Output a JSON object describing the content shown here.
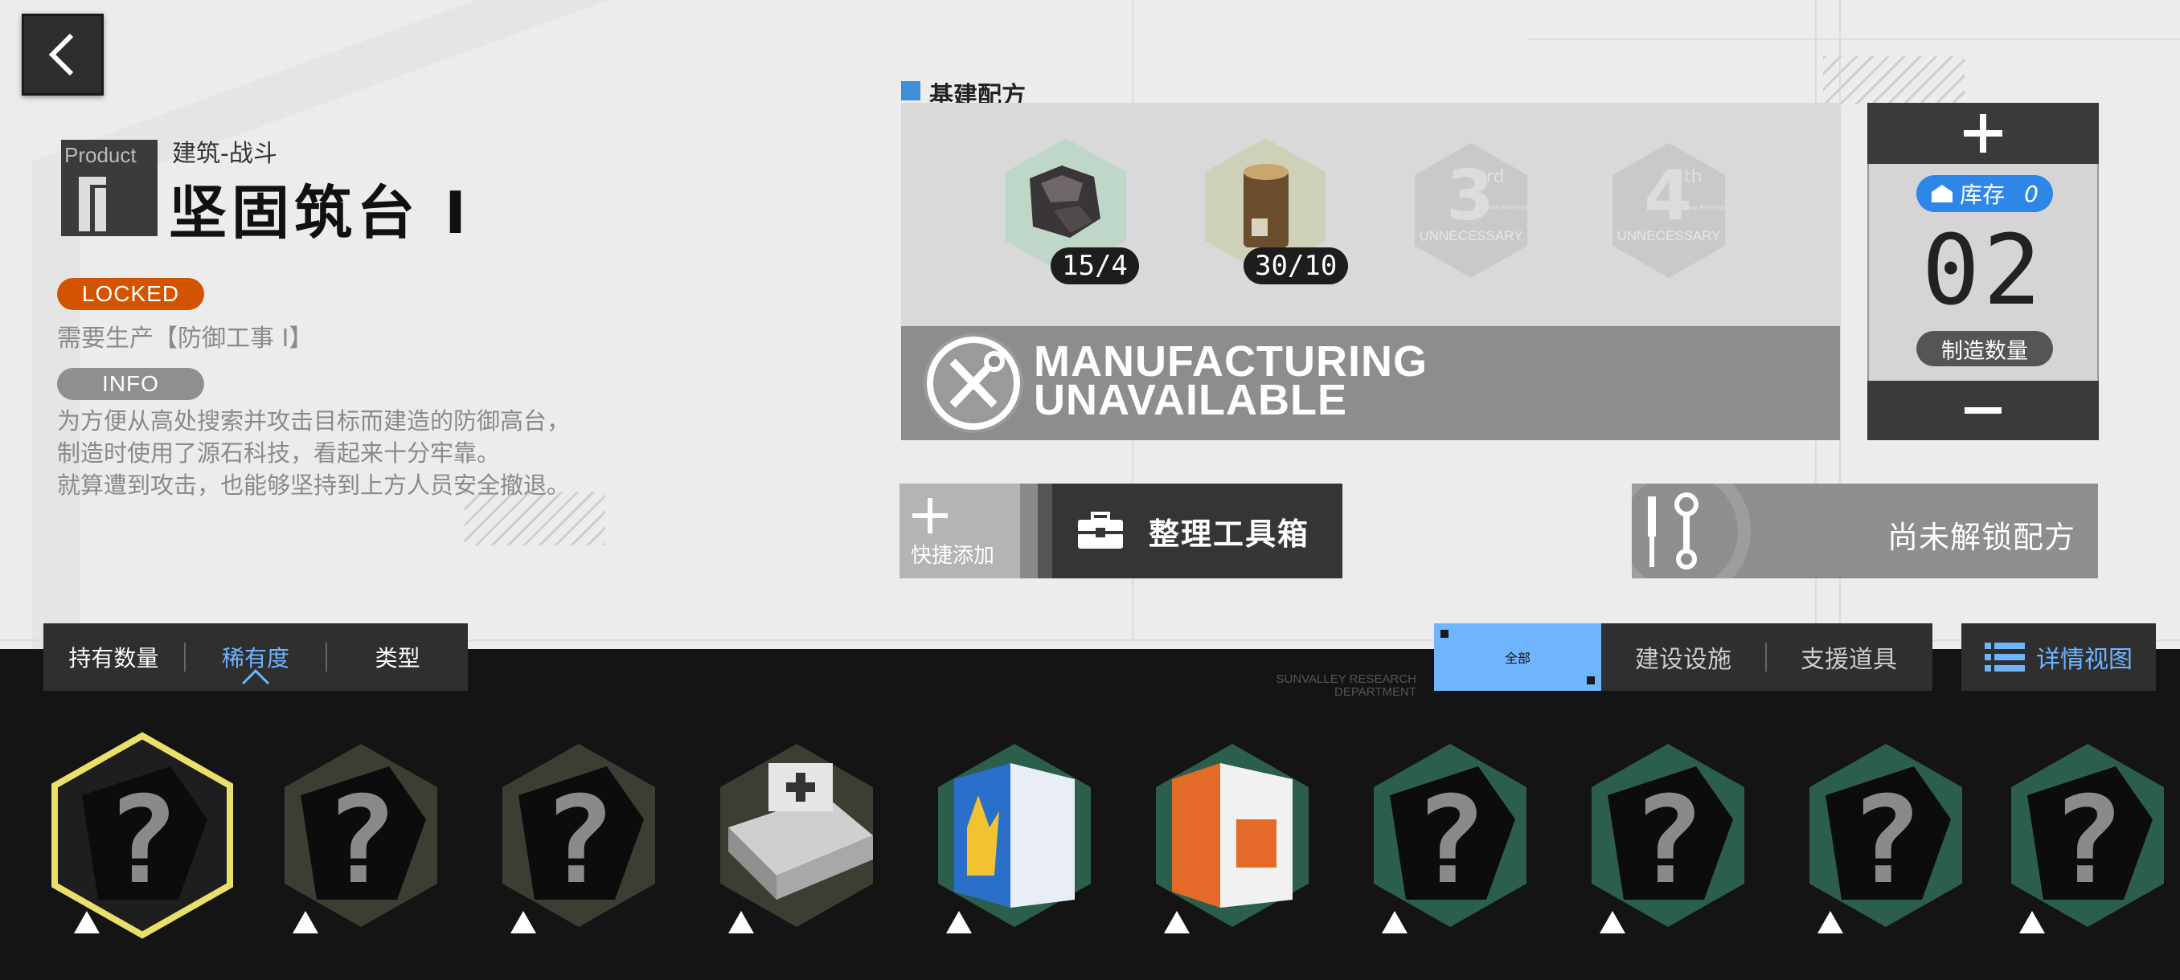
{
  "header": {
    "back_icon": "chevron-left-icon",
    "product_tag": "Product",
    "category": "建筑-战斗",
    "title": "坚固筑台 I"
  },
  "status": {
    "locked_label": "LOCKED",
    "requirement": "需要生产【防御工事 I】",
    "info_label": "INFO",
    "description": [
      "为方便从高处搜索并攻击目标而建造的防御高台，",
      "制造时使用了源石科技，看起来十分牢靠。",
      "就算遭到攻击，也能够坚持到上方人员安全撤退。"
    ]
  },
  "recipe": {
    "label": "基建配方",
    "materials": [
      {
        "name": "material-ore-icon",
        "count": "15/4"
      },
      {
        "name": "material-wood-icon",
        "count": "30/10"
      }
    ],
    "unnecessary": [
      {
        "ordinal": "3",
        "suffix": "rd",
        "tiny": "Raw Material",
        "label": "UNNECESSARY"
      },
      {
        "ordinal": "4",
        "suffix": "th",
        "tiny": "Raw Material",
        "label": "UNNECESSARY"
      }
    ],
    "status_line1": "MANUFACTURING",
    "status_line2": "UNAVAILABLE"
  },
  "quantity": {
    "stock_label": "库存",
    "stock_value": "0",
    "value": "02",
    "label": "制造数量"
  },
  "actions": {
    "quick_add": "快捷添加",
    "toolbox": "整理工具箱",
    "not_unlocked": "尚未解锁配方"
  },
  "sort": {
    "items": [
      "持有数量",
      "稀有度",
      "类型"
    ],
    "active": "稀有度"
  },
  "filter": {
    "items": [
      "全部",
      "建设设施",
      "支援道具"
    ],
    "active": "全部"
  },
  "detail_view": "详情视图",
  "watermark": [
    "SUNVALLEY RESEARCH",
    "DEPARTMENT"
  ],
  "inventory": [
    {
      "kind": "unknown",
      "selected": true
    },
    {
      "kind": "unknown"
    },
    {
      "kind": "unknown"
    },
    {
      "kind": "device"
    },
    {
      "kind": "box-blue"
    },
    {
      "kind": "box-orange"
    },
    {
      "kind": "unknown"
    },
    {
      "kind": "unknown"
    },
    {
      "kind": "unknown"
    },
    {
      "kind": "unknown"
    }
  ],
  "colors": {
    "accent_blue": "#6fb4ff",
    "locked_orange": "#d35400",
    "stock_blue": "#2e87e6",
    "selected_yellow": "#e8e06a"
  }
}
